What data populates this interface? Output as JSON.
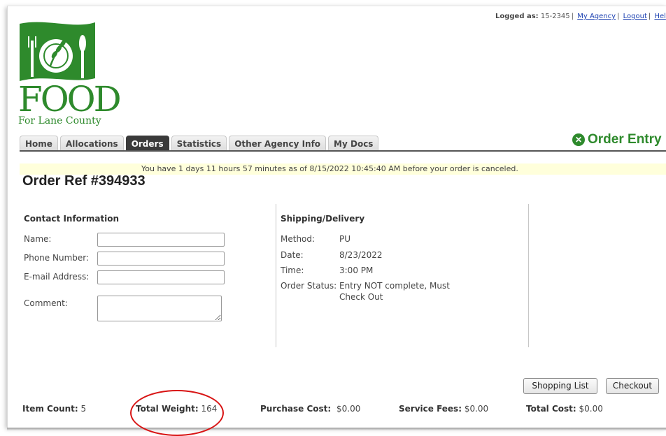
{
  "header": {
    "logged_as_label": "Logged as:",
    "logged_as_value": "15-2345",
    "links": [
      "My Agency",
      "Logout",
      "Hel"
    ],
    "logo_text": "FOOD",
    "logo_sub": "For Lane County"
  },
  "nav": {
    "tabs": [
      {
        "label": "Home",
        "active": false
      },
      {
        "label": "Allocations",
        "active": false
      },
      {
        "label": "Orders",
        "active": true
      },
      {
        "label": "Statistics",
        "active": false
      },
      {
        "label": "Other Agency Info",
        "active": false
      },
      {
        "label": "My Docs",
        "active": false
      }
    ],
    "page_title": "Order Entry"
  },
  "notice": "You have 1 days 11 hours 57 minutes as of 8/15/2022 10:45:40 AM before your order is canceled.",
  "order_ref": "Order Ref #394933",
  "contact": {
    "title": "Contact Information",
    "name_label": "Name:",
    "phone_label": "Phone Number:",
    "email_label": "E-mail Address:",
    "comment_label": "Comment:",
    "name_value": "",
    "phone_value": "",
    "email_value": "",
    "comment_value": ""
  },
  "shipping": {
    "title": "Shipping/Delivery",
    "method_label": "Method:",
    "method_value": "PU",
    "date_label": "Date:",
    "date_value": "8/23/2022",
    "time_label": "Time:",
    "time_value": "3:00 PM",
    "status_label": "Order Status:",
    "status_value_line1": "Entry NOT complete, Must",
    "status_value_line2": "Check Out"
  },
  "buttons": {
    "shopping_list": "Shopping List",
    "checkout": "Checkout"
  },
  "totals": {
    "item_count_label": "Item Count:",
    "item_count_value": "5",
    "total_weight_label": "Total Weight:",
    "total_weight_value": "164",
    "purchase_cost_label": "Purchase Cost:",
    "purchase_cost_value": "$0.00",
    "service_fees_label": "Service Fees:",
    "service_fees_value": "$0.00",
    "total_cost_label": "Total Cost:",
    "total_cost_value": "$0.00"
  },
  "colors": {
    "brand_green": "#2e8a2c",
    "notice_bg": "#ffffdb",
    "highlight_red": "#d81414"
  }
}
